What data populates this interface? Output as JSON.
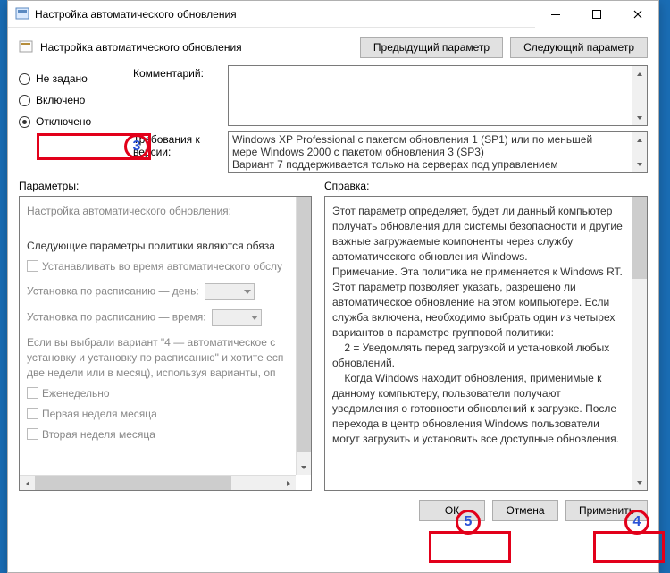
{
  "window": {
    "title": "Настройка автоматического обновления"
  },
  "header": {
    "title": "Настройка автоматического обновления",
    "prev": "Предыдущий параметр",
    "next": "Следующий параметр"
  },
  "radios": {
    "notset": "Не задано",
    "enabled": "Включено",
    "disabled": "Отключено"
  },
  "labels": {
    "comment": "Комментарий:",
    "requirements": "Требования к версии:",
    "params": "Параметры:",
    "help": "Справка:"
  },
  "version_text_lines": [
    "Windows XP Professional с пакетом обновления 1 (SP1) или по меньшей",
    "мере Windows 2000 с пакетом обновления 3 (SP3)",
    "Вариант 7 поддерживается только на серверах под управлением"
  ],
  "params_panel": {
    "title": "Настройка автоматического обновления:",
    "note": "Следующие параметры политики являются обяза",
    "chk1": "Устанавливать во время автоматического обслу",
    "day_label": "Установка по расписанию — день:",
    "time_label": "Установка по расписанию — время:",
    "note2a": "Если вы выбрали вариант \"4 — автоматическое с",
    "note2b": "установку и установку по расписанию\" и хотите есп",
    "note2c": "две недели или в месяц), используя варианты, оп",
    "chk2": "Еженедельно",
    "chk3": "Первая неделя месяца",
    "chk4": "Вторая неделя месяца"
  },
  "help_text": [
    "Этот параметр определяет, будет ли данный компьютер получать обновления для системы безопасности и другие важные загружаемые компоненты через службу автоматического обновления Windows.",
    "",
    "Примечание. Эта политика не применяется к Windows RT.",
    "",
    "Этот параметр позволяет указать, разрешено ли автоматическое обновление на этом компьютере. Если служба включена, необходимо выбрать один из четырех вариантов в параметре групповой политики:",
    "",
    "    2 = Уведомлять перед загрузкой и установкой любых обновлений.",
    "",
    "    Когда Windows находит обновления, применимые к данному компьютеру, пользователи получают уведомления о готовности обновлений к загрузке. После перехода в центр обновления Windows пользователи могут загрузить и установить все доступные обновления."
  ],
  "footer": {
    "ok": "ОК",
    "cancel": "Отмена",
    "apply": "Применить"
  },
  "annot": {
    "n3": "3",
    "n4": "4",
    "n5": "5"
  }
}
